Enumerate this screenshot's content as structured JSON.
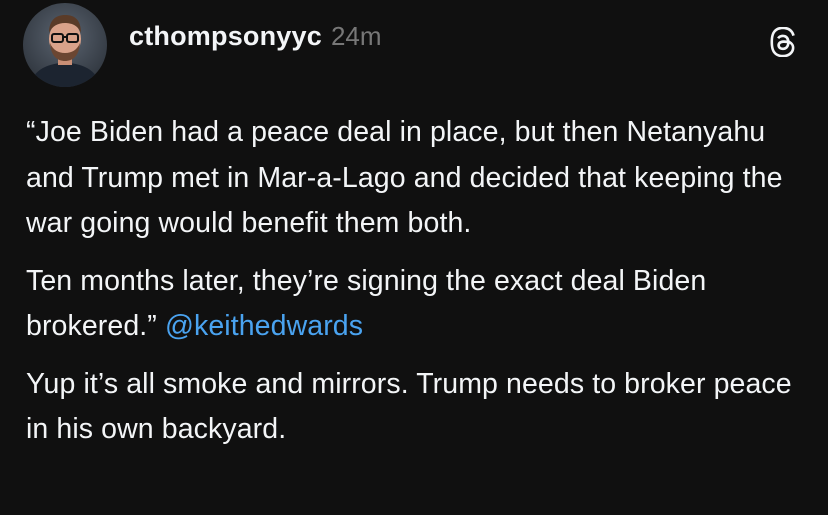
{
  "post": {
    "username": "cthompsonyyc",
    "timestamp": "24m",
    "paragraphs": [
      "“Joe Biden had a peace deal in place, but then Netanyahu and Trump met in Mar-a-Lago and decided that keeping the war going would benefit them both.",
      "Ten months later, they’re signing the exact deal Biden brokered.”",
      "Yup it’s all smoke and mirrors.  Trump needs to broker peace in his own backyard."
    ],
    "mention": "@keithedwards"
  },
  "icons": {
    "app_logo": "threads-logo-icon",
    "avatar": "profile-avatar"
  },
  "colors": {
    "background": "#101010",
    "text": "#f3f5f7",
    "muted": "#777777",
    "link": "#4aa3f0"
  }
}
